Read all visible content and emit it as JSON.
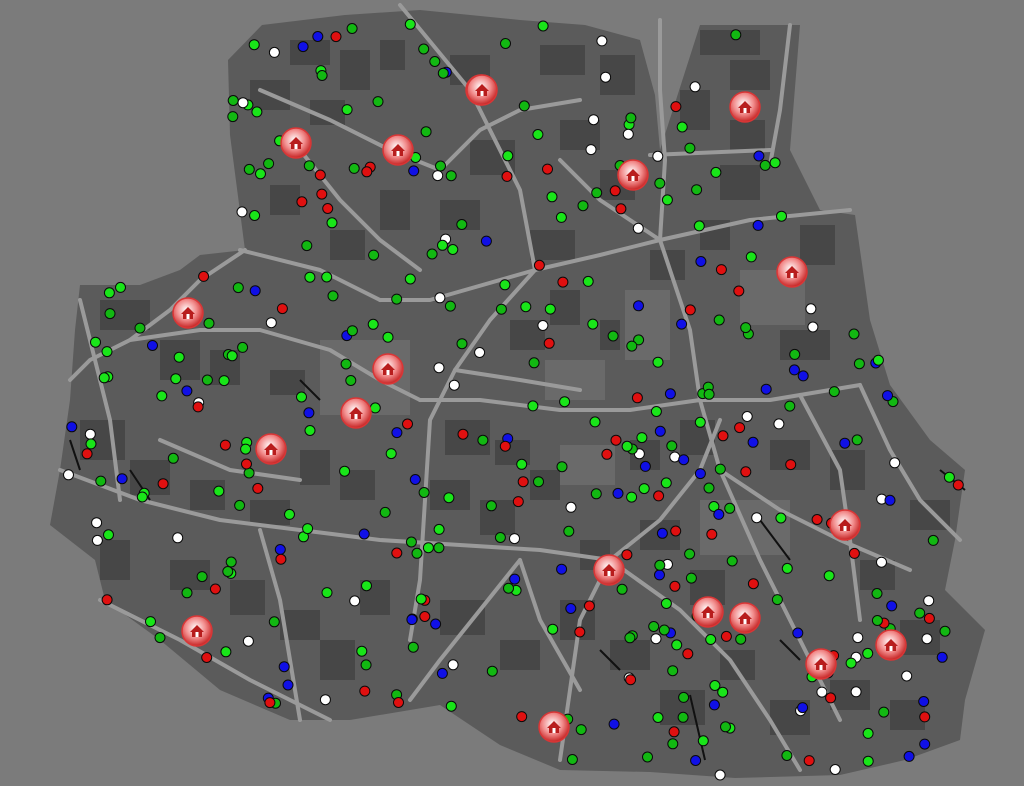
{
  "map": {
    "background": "#7b7b7b",
    "land_color": "#5b5b5b",
    "road_color": "#9a9a9a",
    "building_color": "#474747",
    "open_area_color": "#6a6a6a"
  },
  "legend": {
    "green": {
      "color": "#12b812",
      "meaning": ""
    },
    "green_bright": {
      "color": "#19e519",
      "meaning": ""
    },
    "red": {
      "color": "#e01010",
      "meaning": ""
    },
    "blue": {
      "color": "#1010e6",
      "meaning": ""
    },
    "white": {
      "color": "#ffffff",
      "meaning": ""
    },
    "refuge": {
      "color": "#d93636",
      "icon": "house-icon"
    }
  },
  "counts": {
    "refuges": 19,
    "agents": 420
  }
}
